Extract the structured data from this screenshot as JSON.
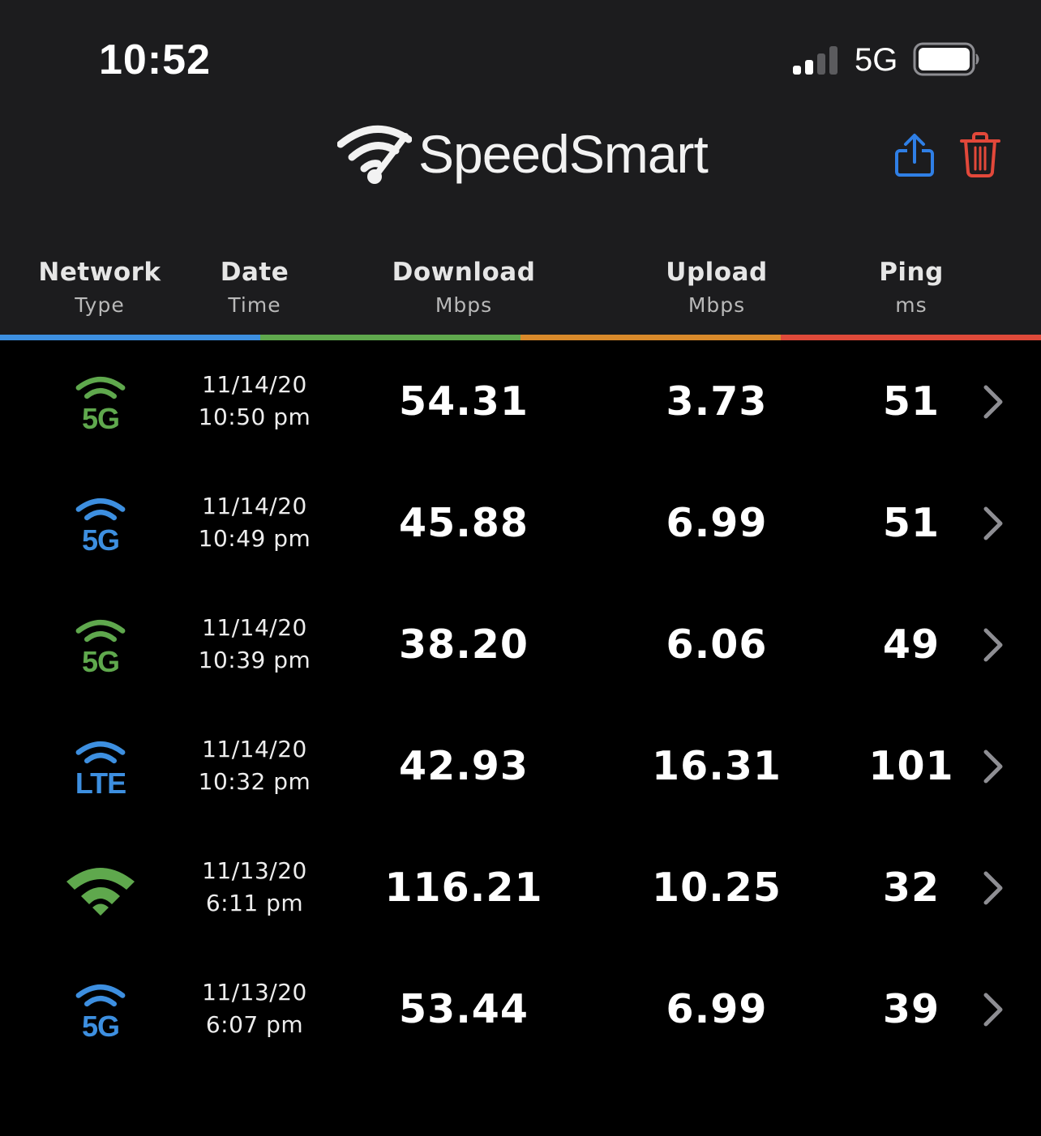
{
  "status_bar": {
    "time": "10:52",
    "network": "5G"
  },
  "app": {
    "name": "SpeedSmart"
  },
  "columns": [
    {
      "title": "Network",
      "sub": "Type"
    },
    {
      "title": "Date",
      "sub": "Time"
    },
    {
      "title": "Download",
      "sub": "Mbps"
    },
    {
      "title": "Upload",
      "sub": "Mbps"
    },
    {
      "title": "Ping",
      "sub": "ms"
    }
  ],
  "colors": {
    "network": "#3d8fe0",
    "date": "#5fa84d",
    "download": "#d98a2b",
    "upload": "#d98a2b",
    "ping": "#df4a3a",
    "green": "#5fa84d",
    "blue": "#3d8fe0",
    "share": "#2f7fe6",
    "trash": "#e2483a"
  },
  "results": [
    {
      "network_icon": "wifi-5g-icon",
      "network_label": "5G",
      "icon_color": "#5fa84d",
      "date": "11/14/20",
      "time": "10:50 pm",
      "download": "54.31",
      "upload": "3.73",
      "ping": "51"
    },
    {
      "network_icon": "wifi-5g-icon",
      "network_label": "5G",
      "icon_color": "#3d8fe0",
      "date": "11/14/20",
      "time": "10:49 pm",
      "download": "45.88",
      "upload": "6.99",
      "ping": "51"
    },
    {
      "network_icon": "wifi-5g-icon",
      "network_label": "5G",
      "icon_color": "#5fa84d",
      "date": "11/14/20",
      "time": "10:39 pm",
      "download": "38.20",
      "upload": "6.06",
      "ping": "49"
    },
    {
      "network_icon": "lte-icon",
      "network_label": "LTE",
      "icon_color": "#3d8fe0",
      "date": "11/14/20",
      "time": "10:32 pm",
      "download": "42.93",
      "upload": "16.31",
      "ping": "101"
    },
    {
      "network_icon": "wifi-icon",
      "network_label": "",
      "icon_color": "#5fa84d",
      "date": "11/13/20",
      "time": "6:11 pm",
      "download": "116.21",
      "upload": "10.25",
      "ping": "32"
    },
    {
      "network_icon": "wifi-5g-icon",
      "network_label": "5G",
      "icon_color": "#3d8fe0",
      "date": "11/13/20",
      "time": "6:07 pm",
      "download": "53.44",
      "upload": "6.99",
      "ping": "39"
    }
  ]
}
